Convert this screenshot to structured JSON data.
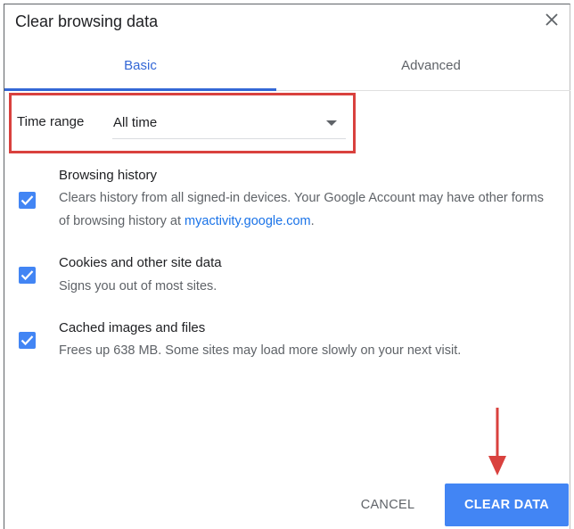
{
  "dialog": {
    "title": "Clear browsing data"
  },
  "tabs": [
    {
      "label": "Basic",
      "active": true
    },
    {
      "label": "Advanced",
      "active": false
    }
  ],
  "time_range": {
    "label": "Time range",
    "value": "All time"
  },
  "options": [
    {
      "title": "Browsing history",
      "description": "Clears history from all signed-in devices. Your Google Account may have other forms of browsing history at ",
      "link": "myactivity.google.com",
      "description_end": ".",
      "checked": true
    },
    {
      "title": "Cookies and other site data",
      "description": "Signs you out of most sites.",
      "checked": true
    },
    {
      "title": "Cached images and files",
      "description": "Frees up 638 MB. Some sites may load more slowly on your next visit.",
      "checked": true
    }
  ],
  "buttons": {
    "cancel": "CANCEL",
    "clear": "CLEAR DATA"
  },
  "colors": {
    "accent": "#4285f4",
    "tab_active": "#3367d6",
    "highlight_box": "#d9413e",
    "arrow": "#d9413e",
    "link": "#1a73e8"
  },
  "icons": {
    "close": "close-icon",
    "dropdown": "chevron-down-icon",
    "checkbox": "checkmark-icon",
    "annotation": "down-arrow-icon"
  }
}
